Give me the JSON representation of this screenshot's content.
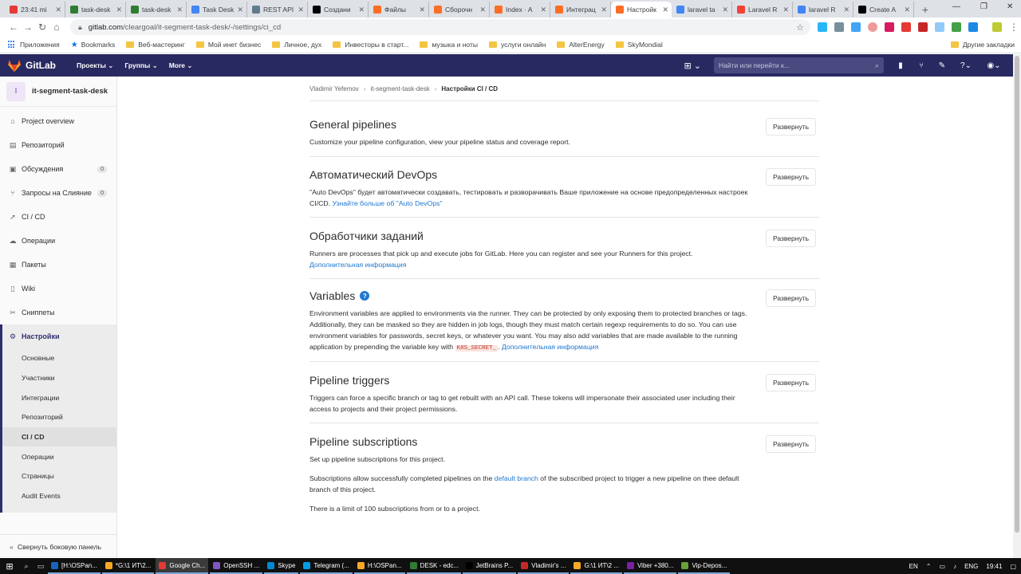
{
  "browser": {
    "tabs": [
      {
        "title": "23:41 mi",
        "color": "#e53935"
      },
      {
        "title": "task-desk",
        "color": "#2e7d32"
      },
      {
        "title": "task-desk",
        "color": "#2e7d32"
      },
      {
        "title": "Task Desk",
        "color": "#4285f4"
      },
      {
        "title": "REST API",
        "color": "#607d8b"
      },
      {
        "title": "Создани",
        "color": "#000000"
      },
      {
        "title": "Файлы",
        "color": "#fc6d26"
      },
      {
        "title": "Сборочн",
        "color": "#fc6d26"
      },
      {
        "title": "Index · A",
        "color": "#fc6d26"
      },
      {
        "title": "Интеграц",
        "color": "#fc6d26"
      },
      {
        "title": "Настройк",
        "color": "#fc6d26"
      },
      {
        "title": "laravel ta",
        "color": "#4285f4"
      },
      {
        "title": "Laravel R",
        "color": "#f44336"
      },
      {
        "title": "laravel R",
        "color": "#4285f4"
      },
      {
        "title": "Create A",
        "color": "#000000"
      }
    ],
    "url_host": "gitlab.com",
    "url_path": "/cleargoal/it-segment-task-desk/-/settings/ci_cd",
    "bookmarks": [
      "Приложения",
      "Bookmarks",
      "Веб-мастеринг",
      "Мой инет бизнес",
      "Личное, дух",
      "Инвесторы в старт...",
      "музыка и ноты",
      "услуги онлайн",
      "AlterEnergy",
      "SkyMondial"
    ],
    "other_bookmarks": "Другие закладки"
  },
  "gitlab": {
    "brand": "GitLab",
    "nav": [
      "Проекты ⌄",
      "Группы ⌄",
      "More ⌄"
    ],
    "search_placeholder": "Найти или перейти к...",
    "header_color": "#292961"
  },
  "sidebar": {
    "project_initial": "I",
    "project_name": "it-segment-task-desk",
    "items": [
      {
        "label": "Project overview",
        "icon": "home-icon"
      },
      {
        "label": "Репозиторий",
        "icon": "doc-icon"
      },
      {
        "label": "Обсуждения",
        "icon": "issues-icon",
        "count": "0"
      },
      {
        "label": "Запросы на Слияние",
        "icon": "merge-icon",
        "count": "0"
      },
      {
        "label": "CI / CD",
        "icon": "rocket-icon"
      },
      {
        "label": "Операции",
        "icon": "cloud-icon"
      },
      {
        "label": "Пакеты",
        "icon": "package-icon"
      },
      {
        "label": "Wiki",
        "icon": "book-icon"
      },
      {
        "label": "Сниппеты",
        "icon": "scissors-icon"
      },
      {
        "label": "Настройки",
        "icon": "gear-icon"
      }
    ],
    "settings_sub": [
      "Основные",
      "Участники",
      "Интеграции",
      "Репозиторий",
      "CI / CD",
      "Операции",
      "Страницы",
      "Audit Events"
    ],
    "collapse": "Свернуть боковую панель"
  },
  "breadcrumbs": [
    "Vladimir Yefemov",
    "it-segment-task-desk",
    "Настройки CI / CD"
  ],
  "expand_label": "Развернуть",
  "sections": {
    "general": {
      "title": "General pipelines",
      "desc": "Customize your pipeline configuration, view your pipeline status and coverage report."
    },
    "devops": {
      "title": "Автоматический DevOps",
      "desc": "\"Auto DevOps\" будет автоматически создавать, тестировать и разворачивать Ваше приложение на основе предопределенных настроек CI/CD.",
      "link": "Узнайте больше об \"Auto DevOps\""
    },
    "runners": {
      "title": "Обработчики заданий",
      "desc": "Runners are processes that pick up and execute jobs for GitLab. Here you can register and see your Runners for this project.",
      "link": "Дополнительная информация"
    },
    "variables": {
      "title": "Variables",
      "desc": "Environment variables are applied to environments via the runner. They can be protected by only exposing them to protected branches or tags. Additionally, they can be masked so they are hidden in job logs, though they must match certain regexp requirements to do so. You can use environment variables for passwords, secret keys, or whatever you want. You may also add variables that are made available to the running application by prepending the variable key with",
      "code": "K8S_SECRET_",
      "link": "Дополнительная информация"
    },
    "triggers": {
      "title": "Pipeline triggers",
      "desc": "Triggers can force a specific branch or tag to get rebuilt with an API call. These tokens will impersonate their associated user including their access to projects and their project permissions."
    },
    "subscriptions": {
      "title": "Pipeline subscriptions",
      "desc1": "Set up pipeline subscriptions for this project.",
      "desc2_a": "Subscriptions allow successfully completed pipelines on the",
      "desc2_link": "default branch",
      "desc2_b": "of the subscribed project to trigger a new pipeline on thee default branch of this project.",
      "desc3": "There is a limit of 100 subscriptions from or to a project."
    }
  },
  "taskbar": {
    "apps": [
      "[H:\\OSPan...",
      "*G:\\1 ИТ\\2...",
      "Google Ch...",
      "OpenSSH ...",
      "Skype",
      "Telegram (...",
      "H:\\OSPan...",
      "DESK - edc...",
      "JetBrains P...",
      "Vladimir's ...",
      "G:\\1 ИТ\\2 ...",
      "Viber +380...",
      "Vip-Depos..."
    ],
    "lang": "EN",
    "lang2": "ENG",
    "time": "19:41"
  }
}
